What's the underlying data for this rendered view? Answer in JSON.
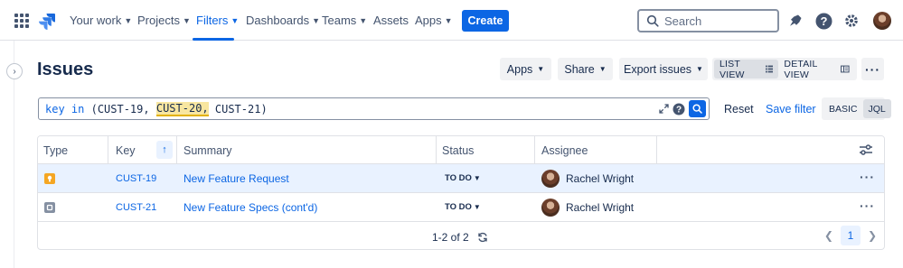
{
  "topnav": {
    "items": [
      {
        "label": "Your work",
        "active": false
      },
      {
        "label": "Projects",
        "active": false
      },
      {
        "label": "Filters",
        "active": true
      },
      {
        "label": "Dashboards",
        "active": false
      },
      {
        "label": "Teams",
        "active": false
      },
      {
        "label": "Assets",
        "active": false
      },
      {
        "label": "Apps",
        "active": false
      }
    ],
    "create_label": "Create",
    "search_placeholder": "Search",
    "icons": [
      "app-switcher-icon",
      "jira-logo",
      "notifications-icon",
      "help-icon",
      "settings-icon"
    ],
    "accent_color": "#0c66e4"
  },
  "page": {
    "title": "Issues",
    "apps_label": "Apps",
    "share_label": "Share",
    "export_label": "Export issues",
    "list_view_label": "LIST VIEW",
    "detail_view_label": "DETAIL VIEW",
    "selected_view": "LIST VIEW"
  },
  "jql": {
    "keyword": "key in",
    "open": " (",
    "item1": "CUST-19,",
    "sp1": " ",
    "item2": "CUST-20,",
    "sp2": " ",
    "item3": "CUST-21)",
    "highlighted": "CUST-20,",
    "reset_label": "Reset",
    "save_label": "Save filter",
    "basic_label": "BASIC",
    "jql_label": "JQL",
    "selected_mode": "JQL"
  },
  "table": {
    "headers": {
      "type": "Type",
      "key": "Key",
      "summary": "Summary",
      "status": "Status",
      "assignee": "Assignee"
    },
    "sort_column": "Key",
    "sort_direction": "ascending",
    "rows": [
      {
        "type": "Idea",
        "type_color": "#f5a623",
        "key": "CUST-19",
        "summary": "New Feature Request",
        "status": "TO DO",
        "assignee": "Rachel Wright",
        "selected": true
      },
      {
        "type": "Task",
        "type_color": "#8590a2",
        "key": "CUST-21",
        "summary": "New Feature Specs (cont'd)",
        "status": "TO DO",
        "assignee": "Rachel Wright",
        "selected": false
      }
    ],
    "footer": {
      "range": "1-2 of 2",
      "current_page": "1"
    }
  }
}
